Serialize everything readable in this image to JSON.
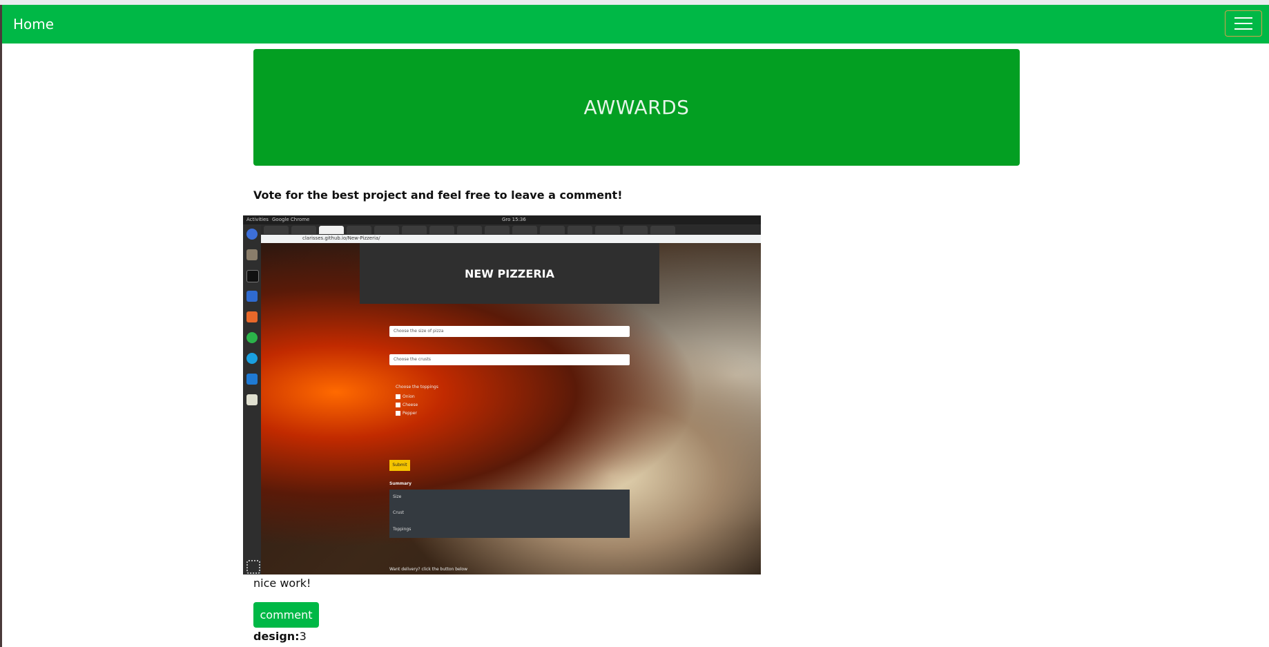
{
  "navbar": {
    "brand": "Home"
  },
  "jumbotron": {
    "title": "AWWARDS"
  },
  "intro": {
    "text": "Vote for the best project and feel free to leave a comment!"
  },
  "project_screenshot": {
    "os": {
      "activities": "Activities",
      "app": "Google Chrome",
      "clock": "Gro 15:36"
    },
    "address": "clarisses.github.io/New-Pizzeria/",
    "header": "NEW PIZZERIA",
    "size_select": "Choose the size of pizza",
    "crust_select": "Choose the crusts",
    "toppings_label": "Choose the toppings",
    "toppings": [
      "Onion",
      "Cheese",
      "Pepper"
    ],
    "submit": "Submit",
    "summary_title": "Summary",
    "summary_rows": [
      "Size",
      "Crust",
      "Toppings"
    ],
    "delivery": "Want delivery? click the button below"
  },
  "comment": {
    "text": "nice work!",
    "button": "comment"
  },
  "rating": {
    "label": "design:",
    "value": "3"
  }
}
